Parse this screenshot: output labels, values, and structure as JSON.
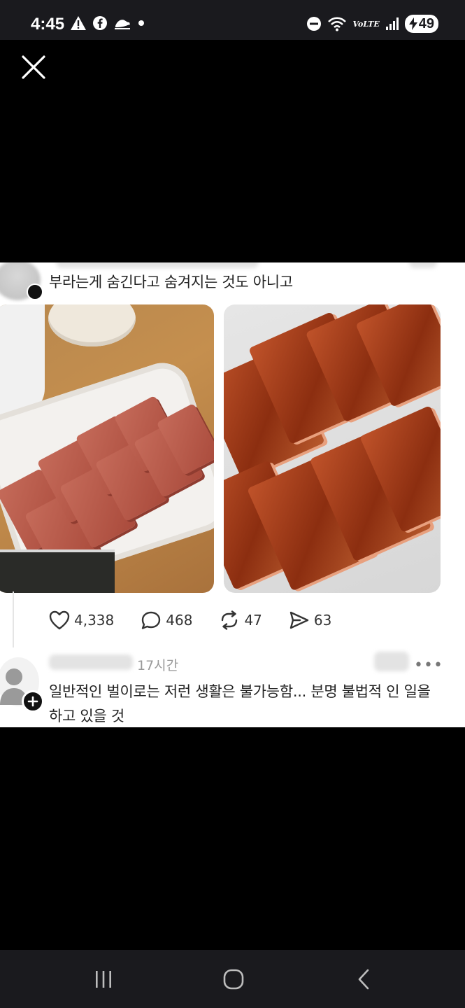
{
  "status_bar": {
    "time": "4:45",
    "left_icons": [
      "warning-icon",
      "facebook-icon",
      "app-icon",
      "dot-icon"
    ],
    "right_icons": [
      "dnd-icon",
      "wifi-icon",
      "volte-icon",
      "signal-icon"
    ],
    "network_label": "VoLTE",
    "battery": "49"
  },
  "viewer": {
    "close_icon": "close-icon"
  },
  "post": {
    "text": "부라는게 숨긴다고 숨겨지는 것도 아니고",
    "photo_left_name": "spam-plate-photo",
    "photo_right_name": "fried-spam-photo",
    "stats": {
      "likes": "4,338",
      "comments": "468",
      "reposts": "47",
      "shares": "63"
    }
  },
  "reply": {
    "time": "17시간",
    "text": "일반적인 벌이로는 저런 생활은 불가능함... 분명 불법적 인 일을 하고 있을 것",
    "more": "•••"
  },
  "nav_bar": {
    "buttons": [
      "recent-apps",
      "home",
      "back"
    ]
  },
  "colors": {
    "background": "#000000",
    "bars": "#1a1a1e",
    "card": "#ffffff",
    "text": "#222222",
    "muted": "#999999"
  }
}
